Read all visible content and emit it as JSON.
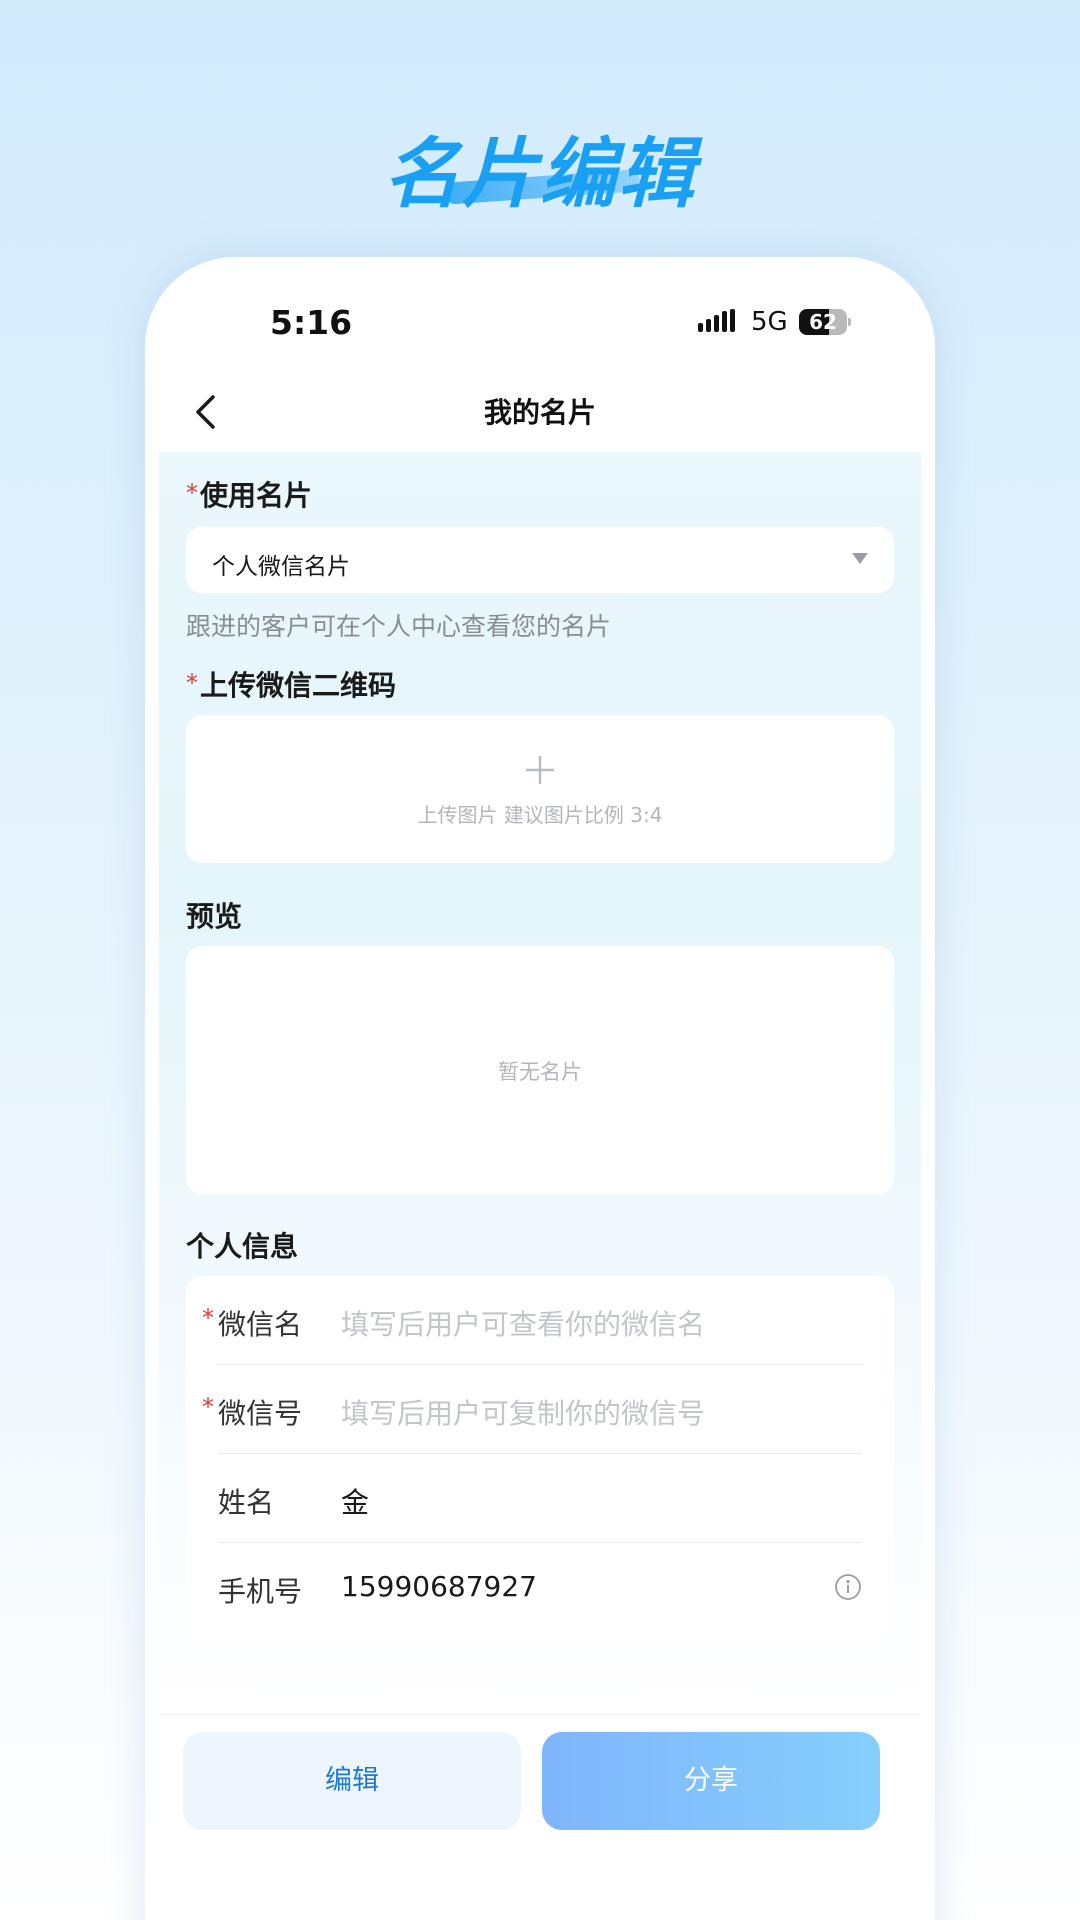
{
  "promo": {
    "title": "名片编辑"
  },
  "status_bar": {
    "time": "5:16",
    "network": "5G",
    "battery": "62",
    "battery_level": 0.62
  },
  "nav": {
    "title": "我的名片",
    "back_icon": "chevron-left-icon"
  },
  "card_select": {
    "label": "使用名片",
    "value": "个人微信名片",
    "hint": "跟进的客户可在个人中心查看您的名片"
  },
  "qr_upload": {
    "label": "上传微信二维码",
    "text": "上传图片 建议图片比例 3:4"
  },
  "preview": {
    "label": "预览",
    "empty_text": "暂无名片"
  },
  "personal_info": {
    "label": "个人信息",
    "rows": [
      {
        "label": "微信名",
        "required": true,
        "placeholder": "填写后用户可查看你的微信名",
        "value": ""
      },
      {
        "label": "微信号",
        "required": true,
        "placeholder": "填写后用户可复制你的微信号",
        "value": ""
      },
      {
        "label": "姓名",
        "required": false,
        "placeholder": "",
        "value": "金"
      },
      {
        "label": "手机号",
        "required": false,
        "placeholder": "",
        "value": "15990687927"
      }
    ]
  },
  "actions": {
    "edit": "编辑",
    "share": "分享"
  },
  "colors": {
    "accent": "#1aa0f2",
    "required": "#e53935",
    "edit_text": "#1e7ad8"
  }
}
